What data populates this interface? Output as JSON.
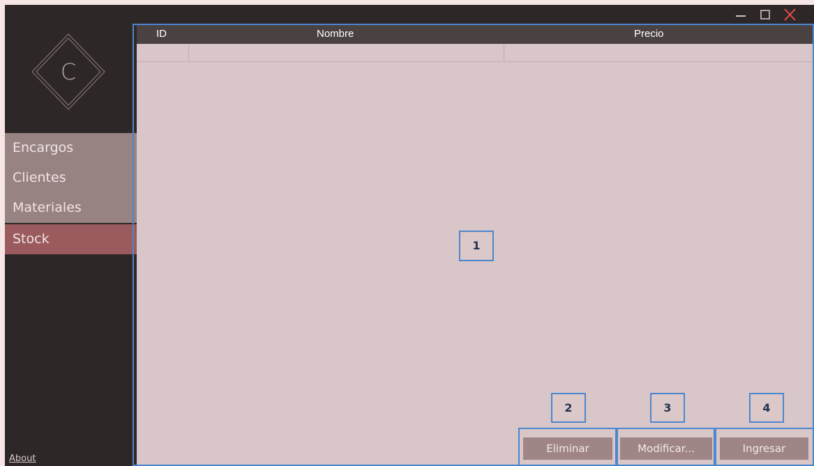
{
  "sidebar": {
    "logo_letter": "C",
    "items": [
      {
        "label": "Encargos"
      },
      {
        "label": "Clientes"
      },
      {
        "label": "Materiales"
      },
      {
        "label": "Stock"
      }
    ],
    "active_item": "Stock",
    "about_label": "About"
  },
  "table": {
    "columns": [
      "ID",
      "Nombre",
      "Precio"
    ],
    "rows": []
  },
  "buttons": {
    "delete_label": "Eliminar",
    "modify_label": "Modificar...",
    "add_label": "Ingresar"
  },
  "callouts": [
    "1",
    "2",
    "3",
    "4"
  ],
  "window_controls": {
    "minimize": "minimize-icon",
    "maximize": "maximize-icon",
    "close": "close-icon"
  },
  "colors": {
    "sidebar_bg": "#2e2727",
    "nav_item_bg": "#988383",
    "nav_active_bg": "#9b5b5e",
    "content_bg": "#d8c6c8",
    "header_bg": "#4a4141",
    "button_bg": "#9f8585",
    "callout_border": "#4a87cf",
    "close_color": "#e84b4b"
  }
}
